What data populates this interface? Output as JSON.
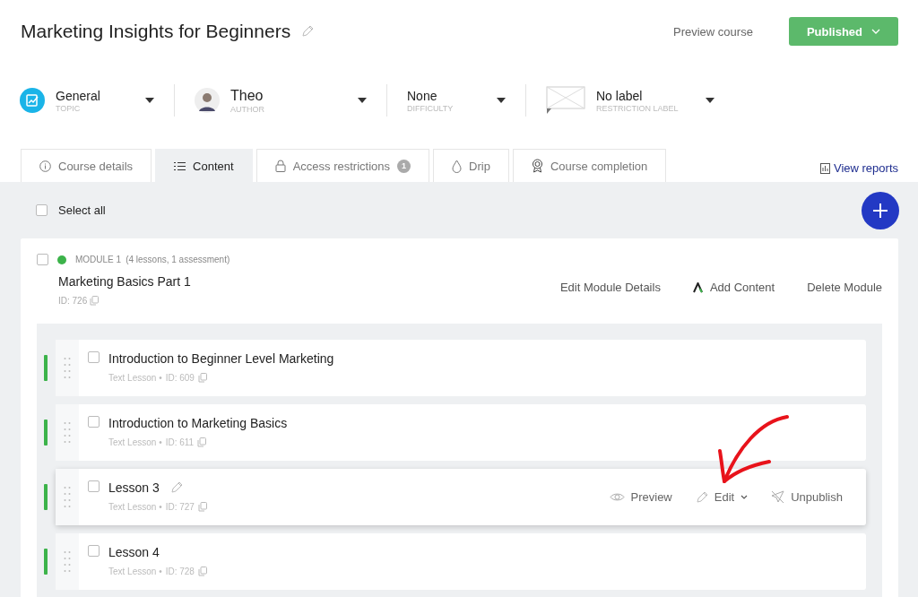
{
  "course_title": "Marketing Insights for Beginners",
  "preview_link": "Preview course",
  "status_button": "Published",
  "meta": [
    {
      "kind": "topic",
      "value": "General",
      "caption": "TOPIC"
    },
    {
      "kind": "author",
      "value": "Theo",
      "caption": "AUTHOR"
    },
    {
      "kind": "difficulty",
      "value": "None",
      "caption": "DIFFICULTY"
    },
    {
      "kind": "label",
      "value": "No label",
      "caption": "RESTRICTION LABEL"
    }
  ],
  "tabs": [
    {
      "kind": "info",
      "label": "Course details",
      "selected": false
    },
    {
      "kind": "list",
      "label": "Content",
      "selected": true
    },
    {
      "kind": "lock",
      "label": "Access restrictions",
      "badge": "1",
      "selected": false
    },
    {
      "kind": "drop",
      "label": "Drip",
      "selected": false
    },
    {
      "kind": "award",
      "label": "Course completion",
      "selected": false
    }
  ],
  "view_reports": "View reports",
  "select_all": {
    "label": "Select all",
    "checked": false
  },
  "module": {
    "checked": false,
    "published": true,
    "heading": "MODULE 1",
    "summary": "(4 lessons, 1 assessment)",
    "title": "Marketing Basics Part 1",
    "id": "ID: 726",
    "actions": [
      {
        "kind": "edit",
        "label": "Edit Module Details"
      },
      {
        "kind": "add",
        "label": "Add Content"
      },
      {
        "kind": "delete",
        "label": "Delete Module"
      }
    ]
  },
  "lessons": [
    {
      "title": "Introduction to Beginner Level Marketing",
      "type": "Text Lesson •",
      "id": "ID: 609",
      "checked": false,
      "published": true,
      "hovered": false
    },
    {
      "title": "Introduction to Marketing Basics",
      "type": "Text Lesson •",
      "id": "ID: 611",
      "checked": false,
      "published": true,
      "hovered": false
    },
    {
      "title": "Lesson 3",
      "type": "Text Lesson •",
      "id": "ID: 727",
      "checked": false,
      "published": true,
      "hovered": true,
      "actions": [
        {
          "kind": "preview",
          "label": "Preview"
        },
        {
          "kind": "edit",
          "label": "Edit"
        },
        {
          "kind": "unpublish",
          "label": "Unpublish"
        }
      ]
    },
    {
      "title": "Lesson 4",
      "type": "Text Lesson •",
      "id": "ID: 728",
      "checked": false,
      "published": true,
      "hovered": false
    }
  ]
}
